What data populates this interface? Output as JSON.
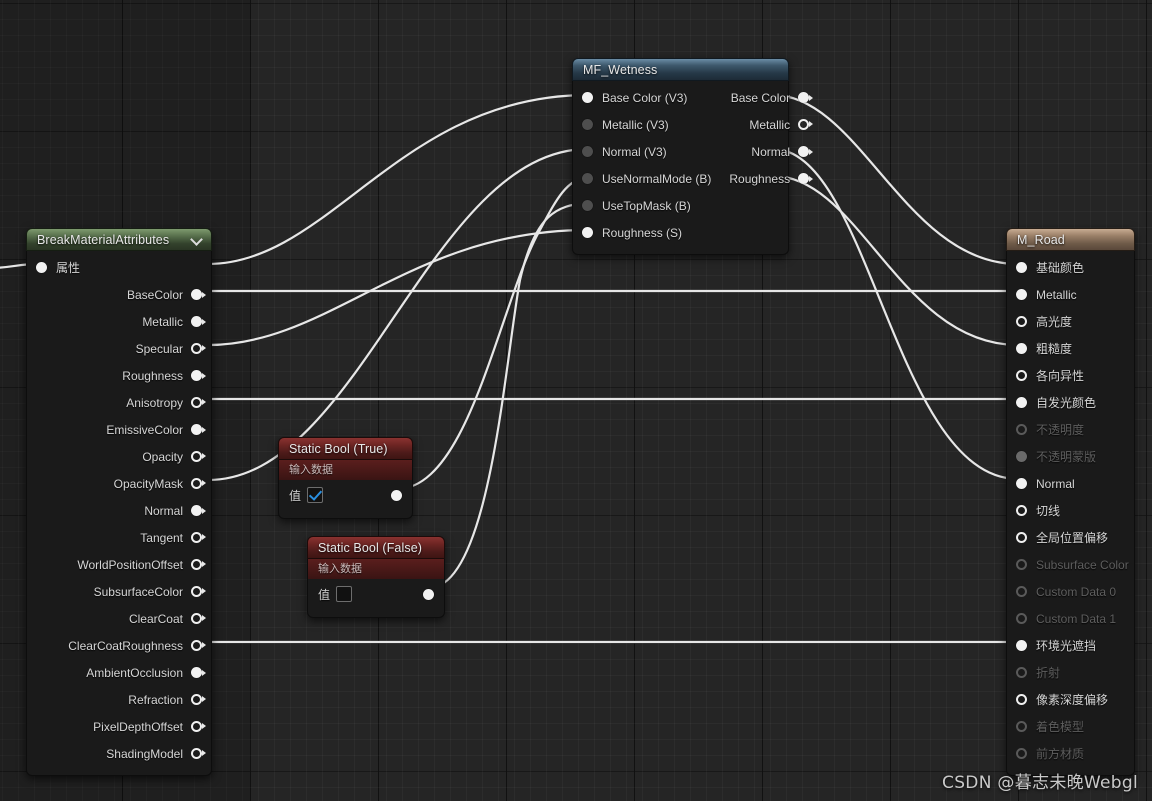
{
  "app": {
    "context": "unreal-material-graph",
    "watermark": "CSDN @暮志未晚Webgl"
  },
  "nodes": {
    "break_material_attributes": {
      "title": "BreakMaterialAttributes",
      "title_color": "#536a48",
      "collapse_icon": "chevron-down-icon",
      "inputs": [
        {
          "label": "属性",
          "style": "filled",
          "connected": true
        }
      ],
      "outputs": [
        {
          "label": "BaseColor",
          "style": "filled",
          "connected": true
        },
        {
          "label": "Metallic",
          "style": "filled",
          "connected": true
        },
        {
          "label": "Specular",
          "style": "hollow",
          "connected": false
        },
        {
          "label": "Roughness",
          "style": "filled",
          "connected": true
        },
        {
          "label": "Anisotropy",
          "style": "hollow",
          "connected": false
        },
        {
          "label": "EmissiveColor",
          "style": "filled",
          "connected": true
        },
        {
          "label": "Opacity",
          "style": "hollow",
          "connected": false
        },
        {
          "label": "OpacityMask",
          "style": "hollow",
          "connected": false
        },
        {
          "label": "Normal",
          "style": "filled",
          "connected": true
        },
        {
          "label": "Tangent",
          "style": "hollow",
          "connected": false
        },
        {
          "label": "WorldPositionOffset",
          "style": "hollow",
          "connected": false
        },
        {
          "label": "SubsurfaceColor",
          "style": "hollow",
          "connected": false
        },
        {
          "label": "ClearCoat",
          "style": "hollow",
          "connected": false
        },
        {
          "label": "ClearCoatRoughness",
          "style": "hollow",
          "connected": false
        },
        {
          "label": "AmbientOcclusion",
          "style": "filled",
          "connected": true
        },
        {
          "label": "Refraction",
          "style": "hollow",
          "connected": false
        },
        {
          "label": "PixelDepthOffset",
          "style": "hollow",
          "connected": false
        },
        {
          "label": "ShadingModel",
          "style": "hollow",
          "connected": false
        }
      ]
    },
    "mf_wetness": {
      "title": "MF_Wetness",
      "title_color": "#3e596d",
      "inputs": [
        {
          "label": "Base Color (V3)",
          "style": "filled",
          "connected": true
        },
        {
          "label": "Metallic (V3)",
          "style": "mid",
          "connected": true
        },
        {
          "label": "Normal (V3)",
          "style": "mid",
          "connected": true
        },
        {
          "label": "UseNormalMode (B)",
          "style": "mid",
          "connected": true
        },
        {
          "label": "UseTopMask (B)",
          "style": "mid",
          "connected": true
        },
        {
          "label": "Roughness (S)",
          "style": "filled",
          "connected": true
        }
      ],
      "outputs": [
        {
          "label": "Base Color",
          "style": "filled",
          "connected": true
        },
        {
          "label": "Metallic",
          "style": "hollow",
          "connected": true
        },
        {
          "label": "Normal",
          "style": "filled",
          "connected": true
        },
        {
          "label": "Roughness",
          "style": "filled",
          "connected": true
        }
      ]
    },
    "static_bool_true": {
      "title": "Static Bool (True)",
      "subtitle": "输入数据",
      "title_color": "#6d2523",
      "value_label": "值",
      "value_checked": true,
      "output": {
        "style": "filled",
        "connected": true
      }
    },
    "static_bool_false": {
      "title": "Static Bool (False)",
      "subtitle": "输入数据",
      "title_color": "#6d2523",
      "value_label": "值",
      "value_checked": false,
      "output": {
        "style": "filled",
        "connected": true
      }
    },
    "m_road": {
      "title": "M_Road",
      "title_color": "#9b8068",
      "inputs": [
        {
          "label": "基础颜色",
          "style": "filled",
          "enabled": true,
          "connected": true
        },
        {
          "label": "Metallic",
          "style": "filled",
          "enabled": true,
          "connected": true
        },
        {
          "label": "高光度",
          "style": "hollow",
          "enabled": true,
          "connected": false
        },
        {
          "label": "粗糙度",
          "style": "filled",
          "enabled": true,
          "connected": true
        },
        {
          "label": "各向异性",
          "style": "hollow",
          "enabled": true,
          "connected": false
        },
        {
          "label": "自发光颜色",
          "style": "filled",
          "enabled": true,
          "connected": true
        },
        {
          "label": "不透明度",
          "style": "hollow",
          "enabled": false,
          "connected": false
        },
        {
          "label": "不透明蒙版",
          "style": "filled",
          "enabled": false,
          "connected": false
        },
        {
          "label": "Normal",
          "style": "filled",
          "enabled": true,
          "connected": true
        },
        {
          "label": "切线",
          "style": "hollow",
          "enabled": true,
          "connected": false
        },
        {
          "label": "全局位置偏移",
          "style": "hollow",
          "enabled": true,
          "connected": false
        },
        {
          "label": "Subsurface Color",
          "style": "hollow",
          "enabled": false,
          "connected": false
        },
        {
          "label": "Custom Data 0",
          "style": "hollow",
          "enabled": false,
          "connected": false
        },
        {
          "label": "Custom Data 1",
          "style": "hollow",
          "enabled": false,
          "connected": false
        },
        {
          "label": "环境光遮挡",
          "style": "filled",
          "enabled": true,
          "connected": true
        },
        {
          "label": "折射",
          "style": "hollow",
          "enabled": false,
          "connected": false
        },
        {
          "label": "像素深度偏移",
          "style": "hollow",
          "enabled": true,
          "connected": false
        },
        {
          "label": "着色模型",
          "style": "hollow",
          "enabled": false,
          "connected": false
        },
        {
          "label": "前方材质",
          "style": "hollow",
          "enabled": false,
          "connected": false
        }
      ]
    }
  },
  "connections": [
    {
      "from": "break.BaseColor",
      "to": "wetness.BaseColorIn"
    },
    {
      "from": "break.Roughness",
      "to": "wetness.RoughnessIn"
    },
    {
      "from": "break.Normal",
      "to": "wetness.NormalIn"
    },
    {
      "from": "break.Metallic",
      "to": "road.Metallic"
    },
    {
      "from": "break.EmissiveColor",
      "to": "road.EmissiveColor"
    },
    {
      "from": "break.AmbientOcclusion",
      "to": "road.AmbientOcclusion"
    },
    {
      "from": "boolTrue.out",
      "to": "wetness.UseNormalMode"
    },
    {
      "from": "boolFalse.out",
      "to": "wetness.UseTopMask"
    },
    {
      "from": "wetness.BaseColorOut",
      "to": "road.BaseColor"
    },
    {
      "from": "wetness.NormalOut",
      "to": "road.Normal"
    },
    {
      "from": "wetness.RoughnessOut",
      "to": "road.Roughness"
    }
  ]
}
